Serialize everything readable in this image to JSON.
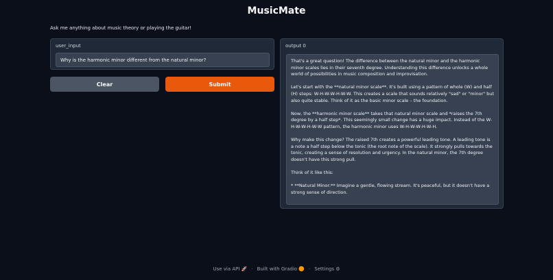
{
  "app": {
    "title": "MusicMate",
    "description": "Ask me anything about music theory or playing the guitar!"
  },
  "input": {
    "label": "user_input",
    "value": "Why is the harmonic minor different from the natural minor?"
  },
  "buttons": {
    "clear_label": "Clear",
    "submit_label": "Submit"
  },
  "output": {
    "label": "output 0",
    "paragraphs": [
      "That's a great question!  The difference between the natural minor and the harmonic minor scales lies in their seventh degree.  Understanding this difference unlocks a whole world of possibilities in music composition and improvisation.",
      "Let's start with the **natural minor scale**.  It's built using a pattern of whole (W) and half (H) steps: W-H-W-W-H-W-W.  This creates a scale that sounds relatively \"sad\" or \"minor\" but also quite stable.  Think of it as the basic minor scale – the foundation.",
      "Now, the **harmonic minor scale** takes that natural minor scale and *raises the 7th degree by a half step*.  This seemingly small change has a huge impact.  Instead of the W-H-W-W-H-W-W pattern, the harmonic minor uses W-H-W-W-H-W-H.",
      "Why make this change?  The raised 7th creates a powerful leading tone.  A leading tone is a note a half step below the tonic (the root note of the scale).  It strongly pulls towards the tonic, creating a sense of resolution and urgency.  In the natural minor, the 7th degree doesn't have this strong pull.",
      "Think of it like this:",
      "* **Natural Minor:**  Imagine a gentle, flowing stream.  It's peaceful, but it doesn't have a strong sense of direction."
    ]
  },
  "footer": {
    "api": "Use via API",
    "built": "Built with Gradio",
    "settings": "Settings"
  }
}
